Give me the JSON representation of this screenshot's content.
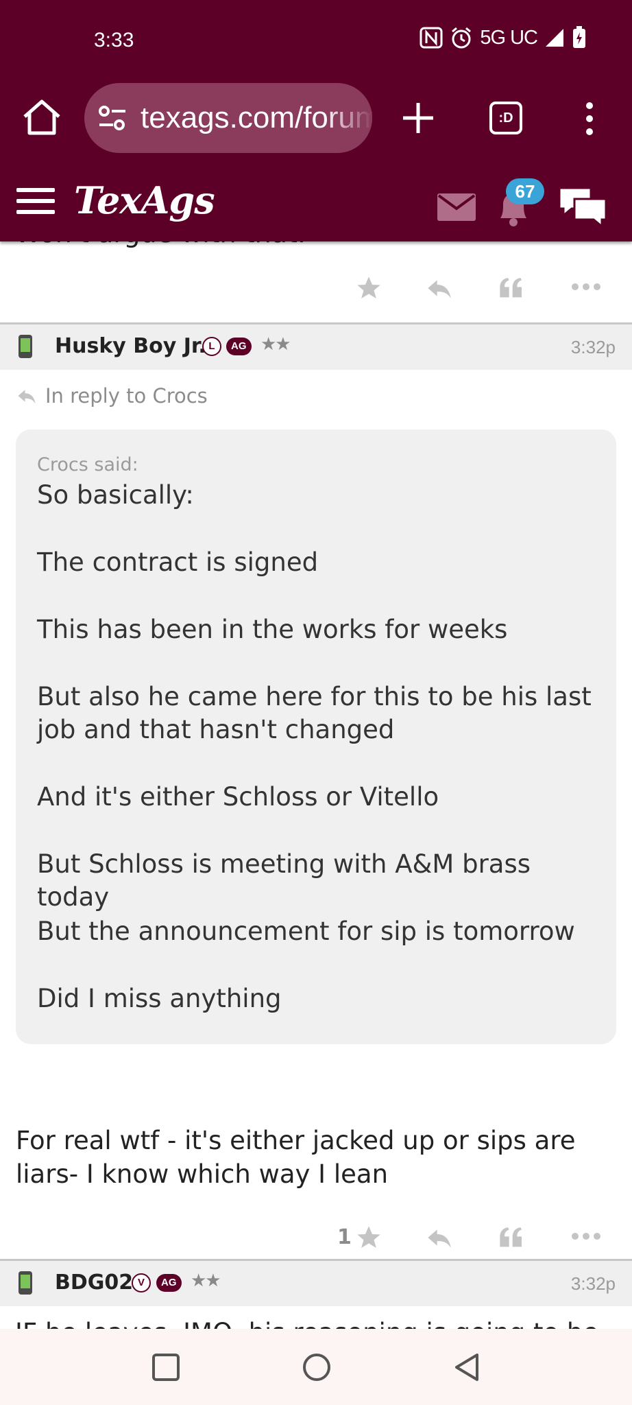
{
  "status_bar": {
    "time": "3:33",
    "network": "5G UC"
  },
  "browser": {
    "url": "texags.com/forums",
    "tab_count": ":D"
  },
  "site": {
    "logo": "TexAgs",
    "notification_count": "67"
  },
  "previous_post": {
    "cut_text": "Won't argue with that."
  },
  "post": {
    "author": "Husky Boy Jr.",
    "badge_letter": "L",
    "badge_ag": "AG",
    "stars": "★★",
    "time": "3:32p",
    "reply_to": "In reply to Crocs",
    "quote": {
      "author": "Crocs said:",
      "lines": [
        "So basically:",
        "The contract is signed",
        "This has been in the works for weeks",
        "But also he came here for this to be his last job and that hasn't changed",
        "And it's either Schloss or Vitello",
        "But Schloss is meeting with A&M brass today",
        "But the announcement for sip is tomorrow",
        "Did I miss anything"
      ]
    },
    "body": "For real wtf - it's either jacked up or sips are liars- I know which way I lean",
    "star_count": "1"
  },
  "next_post": {
    "author": "BDG02",
    "badge_letter": "V",
    "badge_ag": "AG",
    "stars": "★★",
    "time": "3:32p",
    "cut_text": "IF he leaves, IMO, his reasoning is going to be"
  },
  "colors": {
    "maroon": "#5c0028",
    "url_bar": "#8b3b5c",
    "badge_blue": "#3aa4d9"
  }
}
